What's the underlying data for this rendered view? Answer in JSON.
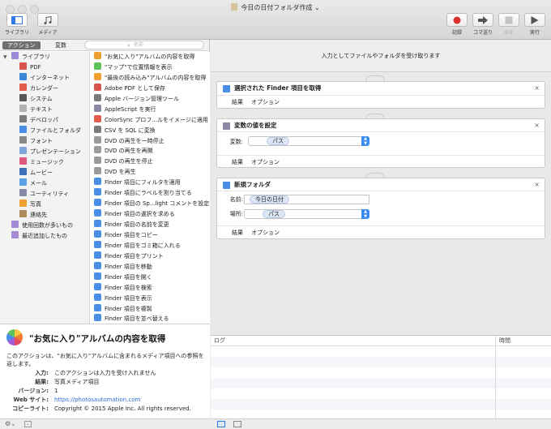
{
  "window": {
    "title": "今日の日付フォルダ作成"
  },
  "toolbar": {
    "library": "ライブラリ",
    "media": "メディア",
    "record": "記録",
    "step": "コマ送り",
    "stop": "中止",
    "run": "実行"
  },
  "sidebar": {
    "tab_actions": "アクション",
    "tab_variables": "変数",
    "search_placeholder": "名前",
    "categories": [
      {
        "label": "ライブラリ",
        "level": 0,
        "color": "#9b8bd6"
      },
      {
        "label": "PDF",
        "level": 1,
        "color": "#d9534f"
      },
      {
        "label": "インターネット",
        "level": 1,
        "color": "#3a86d9"
      },
      {
        "label": "カレンダー",
        "level": 1,
        "color": "#e25b4b"
      },
      {
        "label": "システム",
        "level": 1,
        "color": "#555555"
      },
      {
        "label": "テキスト",
        "level": 1,
        "color": "#b0b0b0"
      },
      {
        "label": "デベロッパ",
        "level": 1,
        "color": "#7a7a7a"
      },
      {
        "label": "ファイルとフォルダ",
        "level": 1,
        "color": "#4a8ee8"
      },
      {
        "label": "フォント",
        "level": 1,
        "color": "#888888"
      },
      {
        "label": "プレゼンテーション",
        "level": 1,
        "color": "#7fa6d8"
      },
      {
        "label": "ミュージック",
        "level": 1,
        "color": "#e0577c"
      },
      {
        "label": "ムービー",
        "level": 1,
        "color": "#3d6fb8"
      },
      {
        "label": "メール",
        "level": 1,
        "color": "#5aa0e6"
      },
      {
        "label": "ユーティリティ",
        "level": 1,
        "color": "#8a8aa6"
      },
      {
        "label": "写真",
        "level": 1,
        "color": "#f0a030"
      },
      {
        "label": "連絡先",
        "level": 1,
        "color": "#b08a5a"
      },
      {
        "label": "使用回数が多いもの",
        "level": 0,
        "color": "#a58ad6"
      },
      {
        "label": "最近追加したもの",
        "level": 0,
        "color": "#a58ad6"
      }
    ],
    "actions": [
      {
        "label": "\"お気に入り\"アルバムの内容を取得",
        "color": "#f0a030"
      },
      {
        "label": "\"マップ\"で位置情報を表示",
        "color": "#5ec25a"
      },
      {
        "label": "\"最後の読み込み\"アルバムの内容を取得",
        "color": "#f0a030"
      },
      {
        "label": "Adobe PDF として保存",
        "color": "#d9534f"
      },
      {
        "label": "Apple バージョン管理ツール",
        "color": "#7a7a7a"
      },
      {
        "label": "AppleScript を実行",
        "color": "#8a8aa6"
      },
      {
        "label": "ColorSync プロフ...ルをイメージに適用",
        "color": "#e25b4b"
      },
      {
        "label": "CSV を SQL に変換",
        "color": "#7a7a7a"
      },
      {
        "label": "DVD の再生を一時停止",
        "color": "#9a9a9a"
      },
      {
        "label": "DVD の再生を再開",
        "color": "#9a9a9a"
      },
      {
        "label": "DVD の再生を停止",
        "color": "#9a9a9a"
      },
      {
        "label": "DVD を再生",
        "color": "#9a9a9a"
      },
      {
        "label": "Finder 項目にフィルタを適用",
        "color": "#4a8ee8"
      },
      {
        "label": "Finder 項目にラベルを割り当てる",
        "color": "#4a8ee8"
      },
      {
        "label": "Finder 項目の Sp...light コメントを設定",
        "color": "#4a8ee8"
      },
      {
        "label": "Finder 項目の選択を求める",
        "color": "#4a8ee8"
      },
      {
        "label": "Finder 項目の名前を変更",
        "color": "#4a8ee8"
      },
      {
        "label": "Finder 項目をコピー",
        "color": "#4a8ee8"
      },
      {
        "label": "Finder 項目をゴミ箱に入れる",
        "color": "#4a8ee8"
      },
      {
        "label": "Finder 項目をプリント",
        "color": "#4a8ee8"
      },
      {
        "label": "Finder 項目を移動",
        "color": "#4a8ee8"
      },
      {
        "label": "Finder 項目を開く",
        "color": "#4a8ee8"
      },
      {
        "label": "Finder 項目を検索",
        "color": "#4a8ee8"
      },
      {
        "label": "Finder 項目を表示",
        "color": "#4a8ee8"
      },
      {
        "label": "Finder 項目を複製",
        "color": "#4a8ee8"
      },
      {
        "label": "Finder 項目を並べ替える",
        "color": "#4a8ee8"
      }
    ]
  },
  "description": {
    "title": "\"お気に入り\"アルバムの内容を取得",
    "body": "このアクションは、\"お気に入り\"アルバムに含まれるメディア項目への参照を返します。",
    "input_label": "入力:",
    "input_value": "このアクションは入力を受け入れません",
    "result_label": "結果:",
    "result_value": "写真メディア項目",
    "version_label": "バージョン:",
    "version_value": "1",
    "website_label": "Web サイト:",
    "website_value": "https://photosautomation.com",
    "copyright_label": "コピーライト:",
    "copyright_value": "Copyright © 2015 Apple Inc. All rights reserved."
  },
  "workflow": {
    "header": "入力としてファイルやフォルダを受け取ります",
    "result_label": "結果",
    "options_label": "オプション",
    "card1_title": "選択された Finder 項目を取得",
    "card2_title": "変数の値を設定",
    "card2_var_label": "変数:",
    "card2_var_value": "パス",
    "card3_title": "新規フォルダ",
    "card3_name_label": "名前:",
    "card3_name_value": "今日の日付",
    "card3_place_label": "場所:",
    "card3_place_value": "パス"
  },
  "log": {
    "col_log": "ログ",
    "col_time": "時間"
  }
}
